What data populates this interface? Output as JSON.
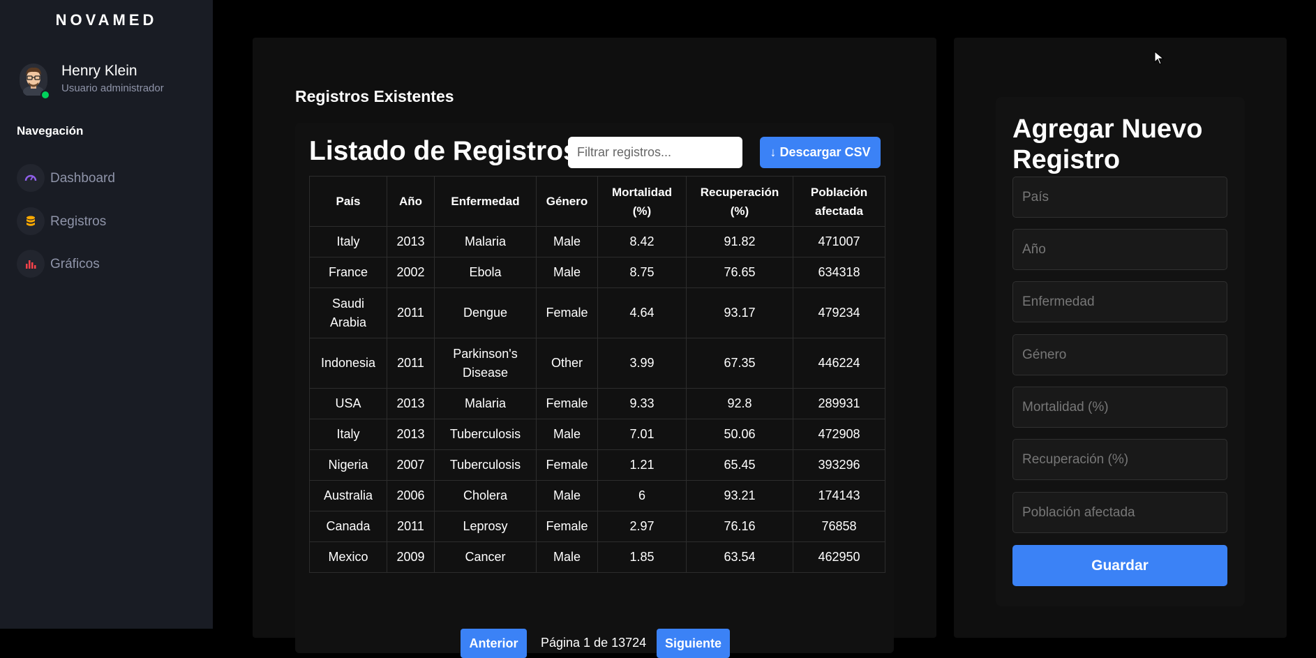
{
  "app": {
    "brand": "NOVAMED"
  },
  "user": {
    "name": "Henry Klein",
    "role": "Usuario administrador"
  },
  "sidebar": {
    "heading": "Navegación",
    "items": [
      {
        "label": "Dashboard",
        "icon": "speedometer-icon",
        "color": "#8f5fe8"
      },
      {
        "label": "Registros",
        "icon": "database-icon",
        "color": "#ffab00"
      },
      {
        "label": "Gráficos",
        "icon": "bar-chart-icon",
        "color": "#fc424a"
      }
    ]
  },
  "main": {
    "section_title": "Registros Existentes",
    "list_title": "Listado de Registros",
    "filter_placeholder": "Filtrar registros...",
    "csv_label": "↓ Descargar CSV",
    "table": {
      "headers": [
        "País",
        "Año",
        "Enfermedad",
        "Género",
        "Mortalidad (%)",
        "Recuperación (%)",
        "Población afectada"
      ],
      "rows": [
        [
          "Italy",
          "2013",
          "Malaria",
          "Male",
          "8.42",
          "91.82",
          "471007"
        ],
        [
          "France",
          "2002",
          "Ebola",
          "Male",
          "8.75",
          "76.65",
          "634318"
        ],
        [
          "Saudi Arabia",
          "2011",
          "Dengue",
          "Female",
          "4.64",
          "93.17",
          "479234"
        ],
        [
          "Indonesia",
          "2011",
          "Parkinson's Disease",
          "Other",
          "3.99",
          "67.35",
          "446224"
        ],
        [
          "USA",
          "2013",
          "Malaria",
          "Female",
          "9.33",
          "92.8",
          "289931"
        ],
        [
          "Italy",
          "2013",
          "Tuberculosis",
          "Male",
          "7.01",
          "50.06",
          "472908"
        ],
        [
          "Nigeria",
          "2007",
          "Tuberculosis",
          "Female",
          "1.21",
          "65.45",
          "393296"
        ],
        [
          "Australia",
          "2006",
          "Cholera",
          "Male",
          "6",
          "93.21",
          "174143"
        ],
        [
          "Canada",
          "2011",
          "Leprosy",
          "Female",
          "2.97",
          "76.16",
          "76858"
        ],
        [
          "Mexico",
          "2009",
          "Cancer",
          "Male",
          "1.85",
          "63.54",
          "462950"
        ]
      ]
    },
    "pagination": {
      "prev_label": "Anterior",
      "info": "Página 1 de 13724",
      "next_label": "Siguiente"
    }
  },
  "form": {
    "title": "Agregar Nuevo Registro",
    "fields": [
      {
        "placeholder": "País"
      },
      {
        "placeholder": "Año"
      },
      {
        "placeholder": "Enfermedad"
      },
      {
        "placeholder": "Género"
      },
      {
        "placeholder": "Mortalidad (%)"
      },
      {
        "placeholder": "Recuperación (%)"
      },
      {
        "placeholder": "Población afectada"
      }
    ],
    "save_label": "Guardar"
  },
  "colors": {
    "accent": "#3b82f6",
    "sidebar_bg": "#191c24",
    "online": "#00d25b"
  }
}
